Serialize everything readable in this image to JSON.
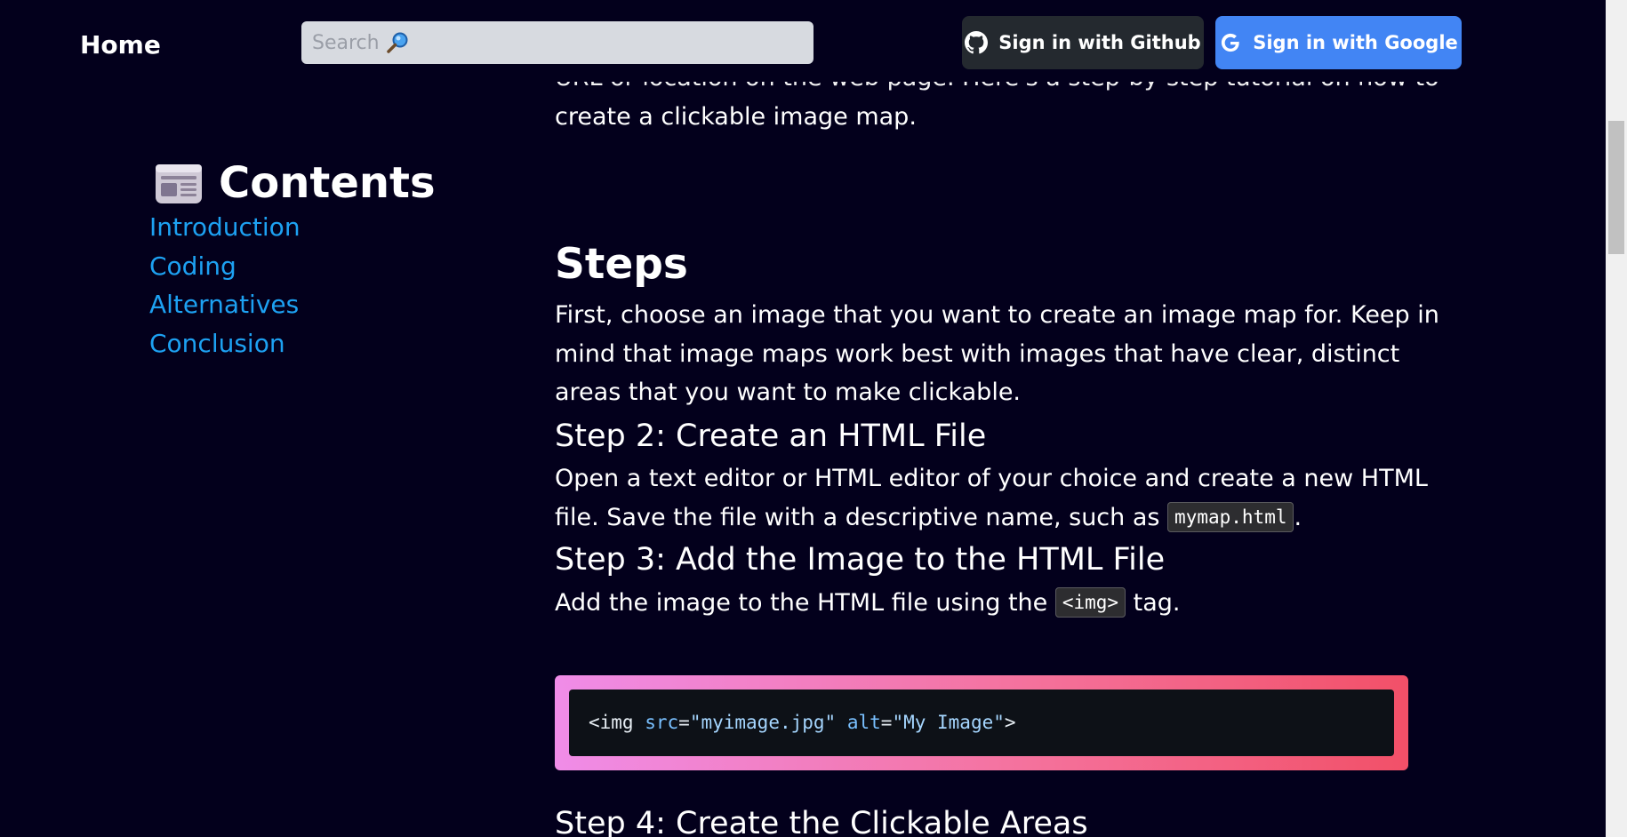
{
  "header": {
    "home_label": "Home",
    "search_placeholder": "Search",
    "github_button_label": "Sign in with Github",
    "google_button_label": "Sign in with Google"
  },
  "toc": {
    "title": "Contents",
    "items": [
      {
        "label": "Introduction"
      },
      {
        "label": "Coding"
      },
      {
        "label": "Alternatives"
      },
      {
        "label": "Conclusion"
      }
    ]
  },
  "article": {
    "intro_line1": "URL or location on the web page. Here's a step-by-step tutorial on how to",
    "intro_line2": "create a clickable image map.",
    "steps_heading": "Steps",
    "steps_paragraph": "First, choose an image that you want to create an image map for. Keep in mind that image maps work best with images that have clear, distinct areas that you want to make clickable.",
    "step2_heading": "Step 2: Create an HTML File",
    "step2_text_before": "Open a text editor or HTML editor of your choice and create a new HTML file. Save the file with a descriptive name, such as ",
    "step2_code": "mymap.html",
    "step2_text_after": ".",
    "step3_heading": "Step 3: Add the Image to the HTML File",
    "step3_text_before": "Add the image to the HTML file using the ",
    "step3_code": "<img>",
    "step3_text_after": " tag.",
    "code_block": {
      "tag_open": "<img ",
      "attr1_name": "src",
      "eq1": "=",
      "attr1_value": "\"myimage.jpg\"",
      "space": " ",
      "attr2_name": "alt",
      "eq2": "=",
      "attr2_value": "\"My Image\"",
      "tag_close": ">"
    },
    "step4_heading": "Step 4: Create the Clickable Areas"
  },
  "colors": {
    "background": "#03001c",
    "link": "#1da1f2",
    "github_button": "#24292f",
    "google_button": "#4285f4",
    "code_gradient_start": "#f08ce8",
    "code_gradient_end": "#f25068"
  }
}
